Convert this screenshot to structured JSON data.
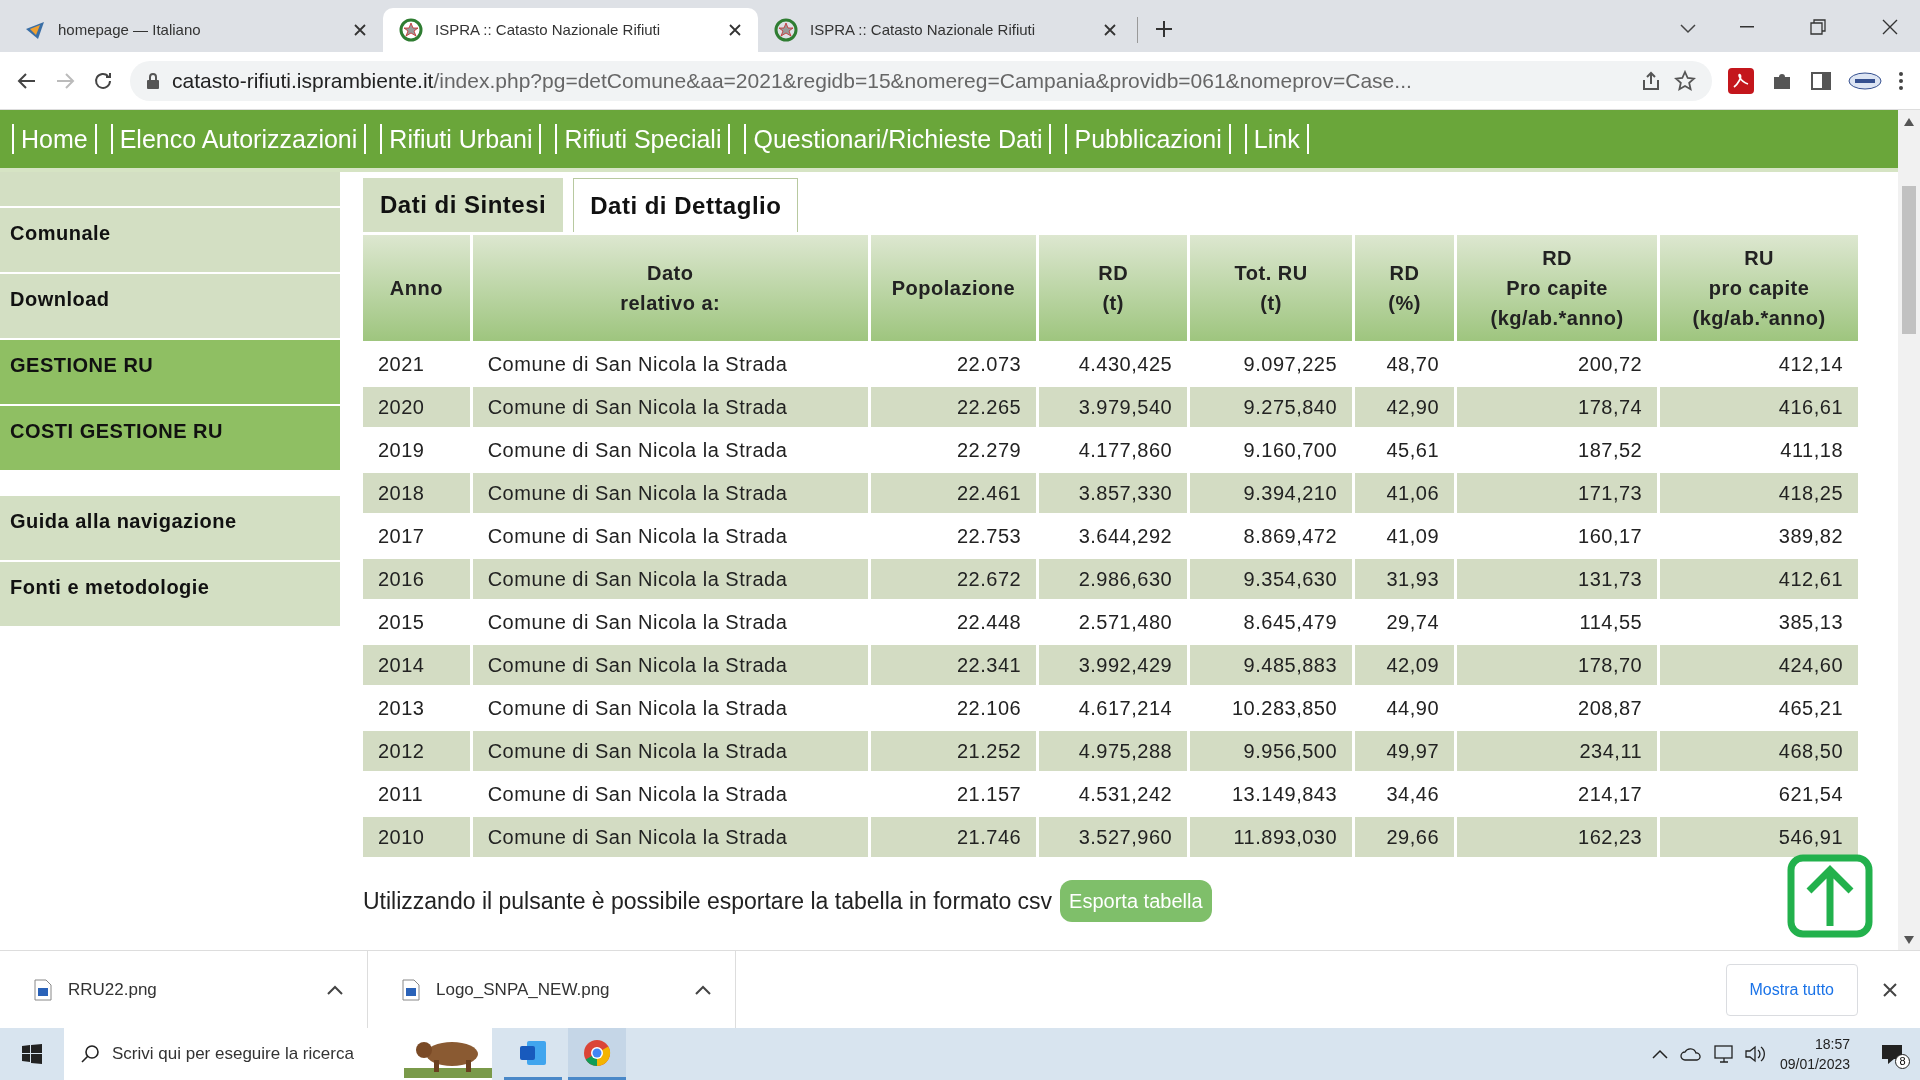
{
  "browser_tabs": [
    {
      "title": "homepage — Italiano",
      "selected": false,
      "kind": "site"
    },
    {
      "title": "ISPRA :: Catasto Nazionale Rifiuti",
      "selected": true,
      "kind": "emblem"
    },
    {
      "title": "ISPRA :: Catasto Nazionale Rifiuti",
      "selected": false,
      "kind": "emblem"
    }
  ],
  "address_bar": {
    "domain": "catasto-rifiuti.isprambiente.it",
    "path": "/index.php?pg=detComune&aa=2021&regidb=15&nomereg=Campania&providb=061&nomeprov=Case..."
  },
  "nav": [
    "Home",
    "Elenco Autorizzazioni",
    "Rifiuti Urbani",
    "Rifiuti Speciali",
    "Questionari/Richieste Dati",
    "Pubblicazioni",
    "Link"
  ],
  "sidebar": {
    "groups": [
      [
        {
          "label": "Comunale",
          "highlighted": false
        },
        {
          "label": "Download",
          "highlighted": false
        },
        {
          "label": "GESTIONE RU",
          "highlighted": true
        },
        {
          "label": "COSTI GESTIONE RU",
          "highlighted": true
        }
      ],
      [
        {
          "label": "Guida alla navigazione",
          "highlighted": false
        },
        {
          "label": "Fonti e metodologie",
          "highlighted": false
        }
      ]
    ]
  },
  "content_tabs": [
    {
      "label": "Dati di Sintesi",
      "selected": false
    },
    {
      "label": "Dati di Dettaglio",
      "selected": true
    }
  ],
  "table": {
    "columns": [
      "Anno",
      "Dato\nrelativo a:",
      "Popolazione",
      "RD\n(t)",
      "Tot. RU\n(t)",
      "RD\n(%)",
      "RD\nPro capite\n(kg/ab.*anno)",
      "RU\npro capite\n(kg/ab.*anno)"
    ],
    "rows": [
      [
        "2021",
        "Comune di San Nicola la Strada",
        "22.073",
        "4.430,425",
        "9.097,225",
        "48,70",
        "200,72",
        "412,14"
      ],
      [
        "2020",
        "Comune di San Nicola la Strada",
        "22.265",
        "3.979,540",
        "9.275,840",
        "42,90",
        "178,74",
        "416,61"
      ],
      [
        "2019",
        "Comune di San Nicola la Strada",
        "22.279",
        "4.177,860",
        "9.160,700",
        "45,61",
        "187,52",
        "411,18"
      ],
      [
        "2018",
        "Comune di San Nicola la Strada",
        "22.461",
        "3.857,330",
        "9.394,210",
        "41,06",
        "171,73",
        "418,25"
      ],
      [
        "2017",
        "Comune di San Nicola la Strada",
        "22.753",
        "3.644,292",
        "8.869,472",
        "41,09",
        "160,17",
        "389,82"
      ],
      [
        "2016",
        "Comune di San Nicola la Strada",
        "22.672",
        "2.986,630",
        "9.354,630",
        "31,93",
        "131,73",
        "412,61"
      ],
      [
        "2015",
        "Comune di San Nicola la Strada",
        "22.448",
        "2.571,480",
        "8.645,479",
        "29,74",
        "114,55",
        "385,13"
      ],
      [
        "2014",
        "Comune di San Nicola la Strada",
        "22.341",
        "3.992,429",
        "9.485,883",
        "42,09",
        "178,70",
        "424,60"
      ],
      [
        "2013",
        "Comune di San Nicola la Strada",
        "22.106",
        "4.617,214",
        "10.283,850",
        "44,90",
        "208,87",
        "465,21"
      ],
      [
        "2012",
        "Comune di San Nicola la Strada",
        "21.252",
        "4.975,288",
        "9.956,500",
        "49,97",
        "234,11",
        "468,50"
      ],
      [
        "2011",
        "Comune di San Nicola la Strada",
        "21.157",
        "4.531,242",
        "13.149,843",
        "34,46",
        "214,17",
        "621,54"
      ],
      [
        "2010",
        "Comune di San Nicola la Strada",
        "21.746",
        "3.527,960",
        "11.893,030",
        "29,66",
        "162,23",
        "546,91"
      ]
    ]
  },
  "export": {
    "text": "Utilizzando il pulsante è possibile esportare la tabella in formato csv",
    "button": "Esporta tabella"
  },
  "downloads": {
    "files": [
      "RRU22.png",
      "Logo_SNPA_NEW.png"
    ],
    "show_all": "Mostra tutto"
  },
  "taskbar": {
    "search_placeholder": "Scrivi qui per eseguire la ricerca",
    "time": "18:57",
    "date": "09/01/2023",
    "notifications": "8"
  }
}
